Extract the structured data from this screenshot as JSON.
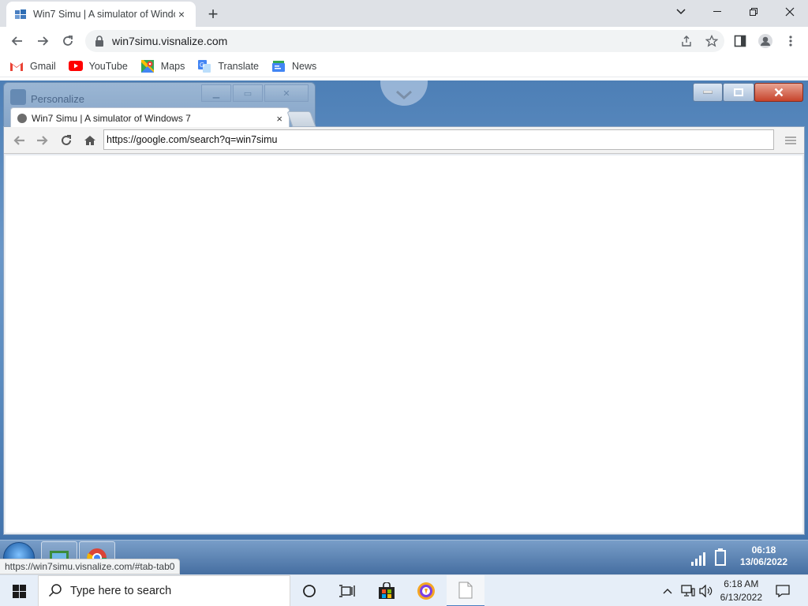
{
  "browser": {
    "tab_title": "Win7 Simu | A simulator of Windows 7",
    "tab_close": "×",
    "new_tab": "+",
    "url": "win7simu.visnalize.com",
    "window_controls": {
      "minimize": "—",
      "maximize": "❐",
      "close": "✕"
    }
  },
  "bookmarks": [
    {
      "label": "Gmail",
      "icon": "gmail-icon",
      "color": "#ea4335"
    },
    {
      "label": "YouTube",
      "icon": "youtube-icon",
      "color": "#ff0000"
    },
    {
      "label": "Maps",
      "icon": "maps-icon",
      "color": "#34a853"
    },
    {
      "label": "Translate",
      "icon": "translate-icon",
      "color": "#4285f4"
    },
    {
      "label": "News",
      "icon": "news-icon",
      "color": "#4285f4"
    }
  ],
  "simulator": {
    "bg_window_title": "Personalize",
    "inner_tab_title": "Win7 Simu | A simulator of Windows 7",
    "inner_tab_close": "×",
    "inner_url": "https://google.com/search?q=win7simu",
    "clock_time": "06:18",
    "clock_date": "13/06/2022"
  },
  "status_bar": "https://win7simu.visnalize.com/#tab-tab0",
  "taskbar": {
    "search_placeholder": "Type here to search",
    "time": "6:18 AM",
    "date": "6/13/2022"
  }
}
